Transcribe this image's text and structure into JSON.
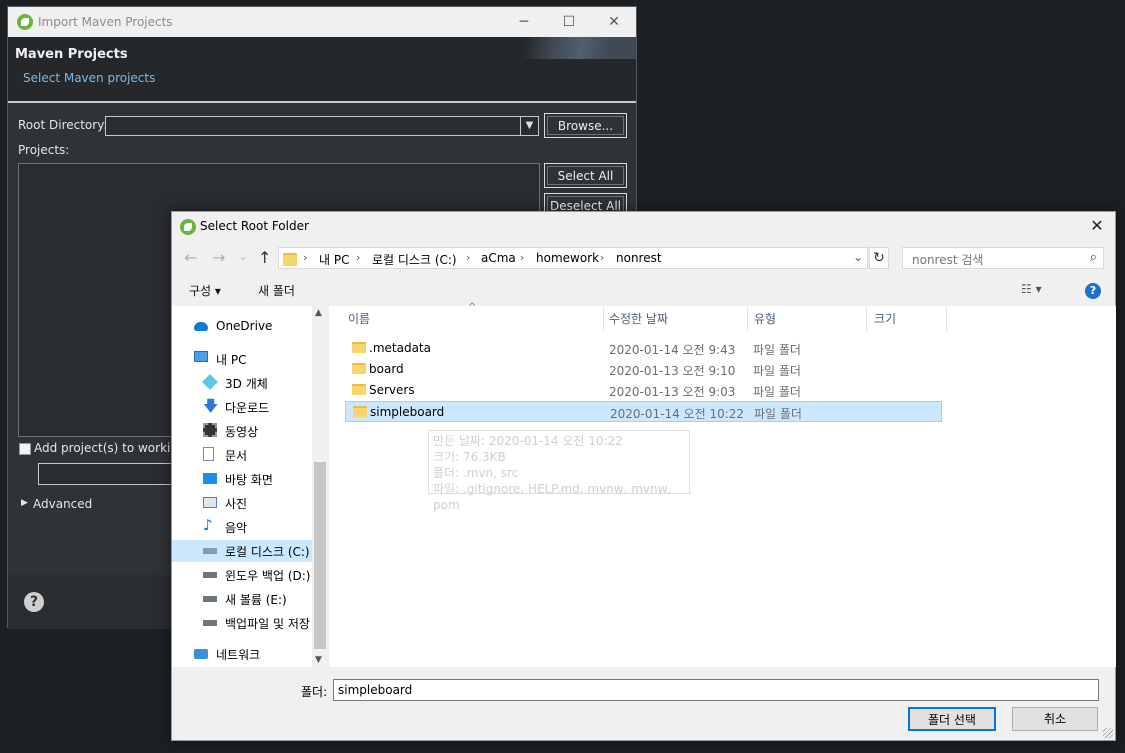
{
  "maven": {
    "title": "Import Maven Projects",
    "header_title": "Maven Projects",
    "header_subtitle": "Select Maven projects",
    "root_label": "Root Directory:",
    "root_value": "",
    "browse": "Browse...",
    "projects_label": "Projects:",
    "select_all": "Select All",
    "deselect_all": "Deselect All",
    "add_working_set": "Add project(s) to working",
    "advanced": "Advanced",
    "help": "?"
  },
  "dialog": {
    "title": "Select Root Folder",
    "close": "✕",
    "breadcrumbs": [
      "내 PC",
      "로컬 디스크 (C:)",
      "aCma",
      "homework",
      "nonrest"
    ],
    "search_placeholder": "nonrest 검색",
    "toolbar": {
      "organize": "구성",
      "new_folder": "새 폴더",
      "help": "?"
    },
    "nav": [
      {
        "label": "OneDrive",
        "icon": "cloud-icon"
      },
      {
        "label": "내 PC",
        "icon": "computer-icon"
      },
      {
        "label": "3D 개체",
        "icon": "cube-icon"
      },
      {
        "label": "다운로드",
        "icon": "download-icon"
      },
      {
        "label": "동영상",
        "icon": "video-icon"
      },
      {
        "label": "문서",
        "icon": "document-icon"
      },
      {
        "label": "바탕 화면",
        "icon": "desktop-icon"
      },
      {
        "label": "사진",
        "icon": "picture-icon"
      },
      {
        "label": "음악",
        "icon": "music-icon"
      },
      {
        "label": "로컬 디스크 (C:)",
        "icon": "drive-icon"
      },
      {
        "label": "윈도우 백업 (D:)",
        "icon": "drive-icon"
      },
      {
        "label": "새 볼륨 (E:)",
        "icon": "drive-icon"
      },
      {
        "label": "백업파일 및 저장",
        "icon": "drive-icon"
      },
      {
        "label": "네트워크",
        "icon": "network-icon"
      }
    ],
    "columns": {
      "name": "이름",
      "date": "수정한 날짜",
      "type": "유형",
      "size": "크기"
    },
    "files": [
      {
        "name": ".metadata",
        "date": "2020-01-14 오전 9:43",
        "type": "파일 폴더"
      },
      {
        "name": "board",
        "date": "2020-01-13 오전 9:10",
        "type": "파일 폴더"
      },
      {
        "name": "Servers",
        "date": "2020-01-13 오전 9:03",
        "type": "파일 폴더"
      },
      {
        "name": "simpleboard",
        "date": "2020-01-14 오전 10:22",
        "type": "파일 폴더"
      }
    ],
    "tooltip": [
      "만든 날짜: 2020-01-14 오전 10:22",
      "크기: 76.3KB",
      "폴더: .mvn, src",
      "파일: .gitignore, HELP.md, mvnw, mvnw, pom"
    ],
    "folder_label": "폴더:",
    "folder_value": "simpleboard",
    "select_button": "폴더 선택",
    "cancel_button": "취소"
  }
}
